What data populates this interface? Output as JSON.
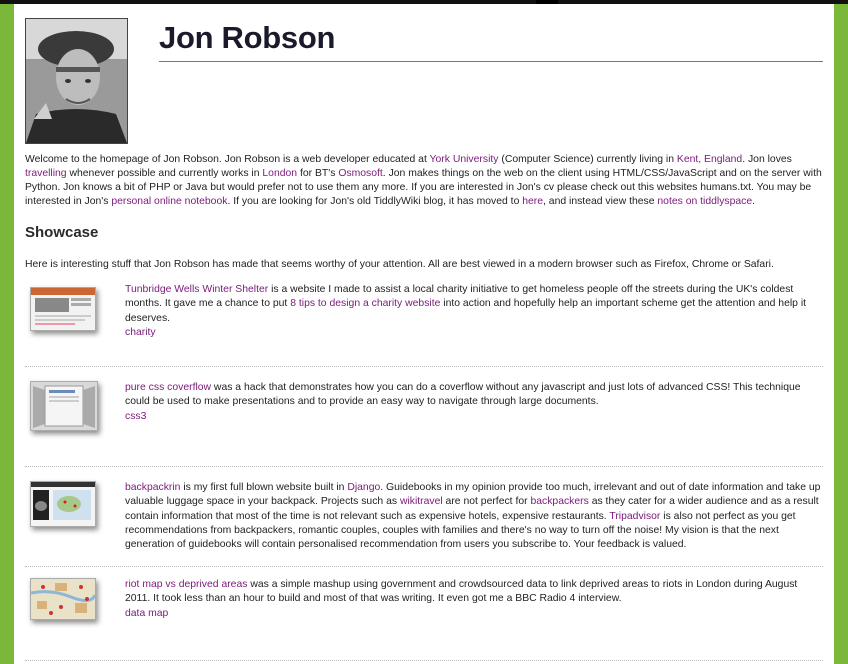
{
  "header": {
    "name": "Jon Robson"
  },
  "intro": {
    "t1": "Welcome to the homepage of Jon Robson. Jon Robson is a web developer educated at ",
    "l_york": "York University",
    "t2": " (Computer Science) currently living in ",
    "l_kent": "Kent, England",
    "t3": ". Jon loves ",
    "l_travelling": "travelling",
    "t4": " whenever possible and currently works in ",
    "l_london": "London",
    "t5": " for BT's ",
    "l_osmosoft": "Osmosoft",
    "t6": ". Jon makes things on the web on the client using HTML/CSS/JavaScript and on the server with Python. Jon knows a bit of PHP or Java but would prefer not to use them any more. If you are interested in Jon's cv please check out this websites humans.txt. You may be interested in Jon's ",
    "l_notebook": "personal online notebook",
    "t7": ". If you are looking for Jon's old TiddlyWiki blog, it has moved to ",
    "l_here": "here",
    "t8": ", and instead view these ",
    "l_notes": "notes on tiddlyspace",
    "t9": "."
  },
  "showcase": {
    "heading": "Showcase",
    "intro": "Here is interesting stuff that Jon Robson has made that seems worthy of your attention. All are best viewed in a modern browser such as Firefox, Chrome or Safari.",
    "items": [
      {
        "title": "Tunbridge Wells Winter Shelter",
        "t1": " is a website I made to assist a local charity initiative to get homeless people off the streets during the UK's coldest months. It gave me a chance to put ",
        "l1": "8 tips to design a charity website",
        "t2": " into action and hopefully help an important scheme get the attention and help it deserves.",
        "tags": "charity"
      },
      {
        "title": "pure css coverflow",
        "t1": " was a hack that demonstrates how you can do a coverflow without any javascript and just lots of advanced CSS! This technique could be used to make presentations and to provide an easy way to navigate through large documents.",
        "tags": "css3"
      },
      {
        "title": "backpackrin",
        "t1": " is my first full blown website built in ",
        "l1": "Django",
        "t2": ". Guidebooks in my opinion provide too much, irrelevant and out of date information and take up valuable luggage space in your backpack. Projects such as ",
        "l2": "wikitravel",
        "t3": " are not perfect for ",
        "l3": "backpackers",
        "t4": " as they cater for a wider audience and as a result contain information that most of the time is not relevant such as expensive hotels, expensive restaurants. ",
        "l4": "Tripadvisor",
        "t5": " is also not perfect as you get recommendations from backpackers, romantic couples, couples with families and there's no way to turn off the noise! My vision is that the next generation of guidebooks will contain personalised recommendation from users you subscribe to. Your feedback is valued."
      },
      {
        "title": "riot map vs deprived areas",
        "t1": " was a simple mashup using government and crowdsourced data to link deprived areas to riots in London during August 2011. It took less than an hour to build and most of that was writing. It even got me a BBC Radio 4 interview.",
        "tags": "data map"
      }
    ]
  },
  "colors": {
    "background": "#7ab83a",
    "link": "#7a1a7a",
    "title": "#1a1a2a"
  }
}
